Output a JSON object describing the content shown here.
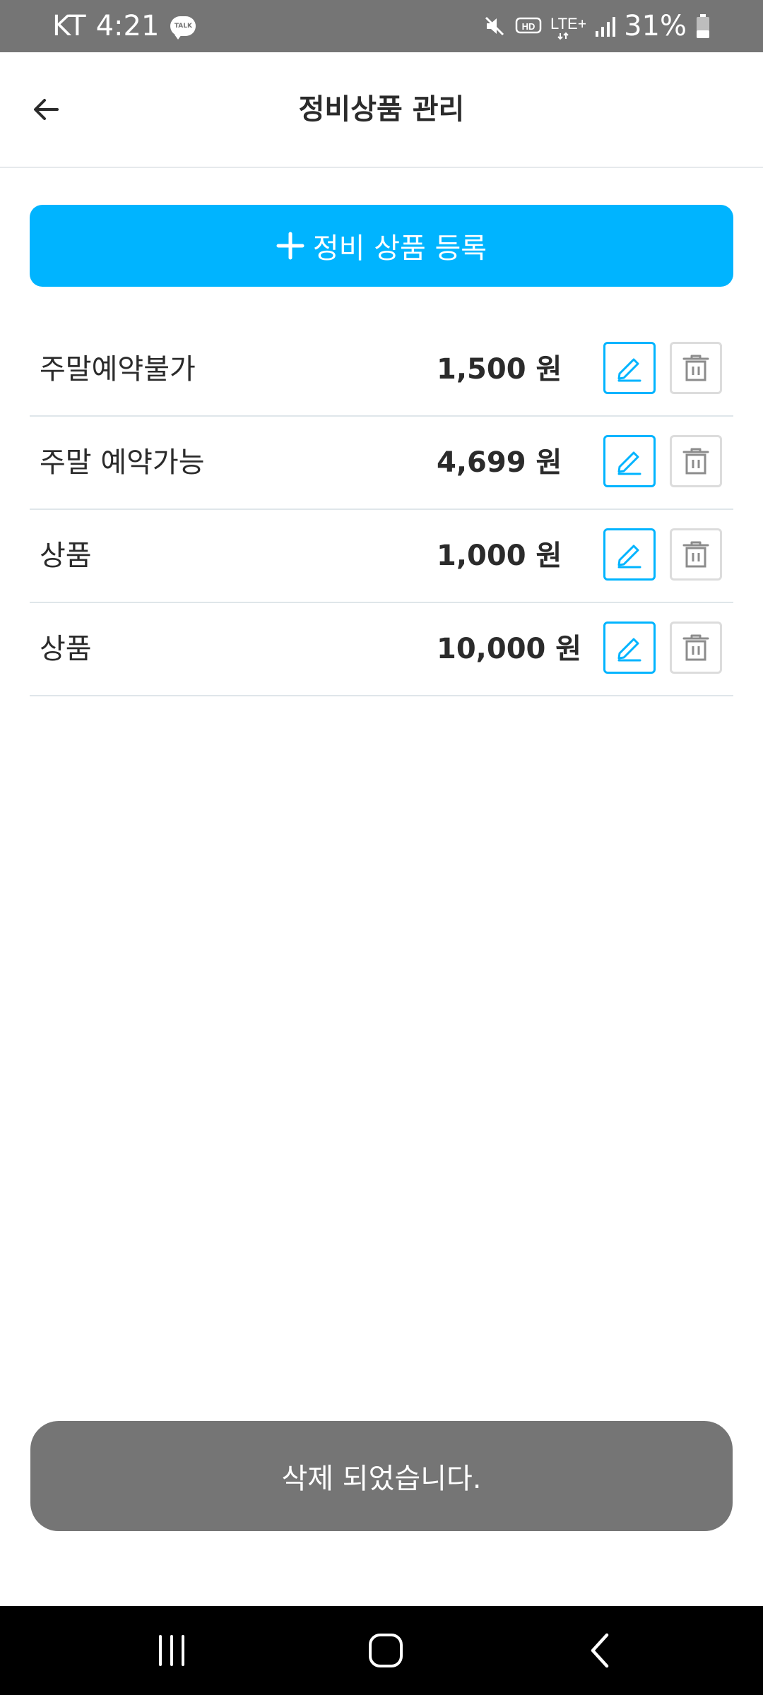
{
  "status_bar": {
    "carrier": "KT",
    "time": "4:21",
    "talk_badge": "TALK",
    "hd_badge": "HD",
    "network": "LTE+",
    "battery": "31%",
    "icons": [
      "kakaotalk-icon",
      "mute-icon",
      "hd-icon",
      "lte-icon",
      "signal-icon",
      "battery-icon"
    ]
  },
  "header": {
    "title": "정비상품 관리",
    "back_icon": "back-arrow-icon"
  },
  "register_button": {
    "label": "정비 상품 등록",
    "icon": "plus-icon"
  },
  "products": [
    {
      "name": "주말예약불가",
      "price": "1,500",
      "unit": "원"
    },
    {
      "name": "주말 예약가능",
      "price": "4,699",
      "unit": "원"
    },
    {
      "name": "상품",
      "price": "1,000",
      "unit": "원"
    },
    {
      "name": "상품",
      "price": "10,000",
      "unit": "원"
    }
  ],
  "row_actions": {
    "edit_icon": "pencil-icon",
    "delete_icon": "trash-icon"
  },
  "toast": {
    "message": "삭제 되었습니다."
  },
  "nav_bar": {
    "buttons": [
      "recent-apps-icon",
      "home-icon",
      "back-icon"
    ]
  },
  "colors": {
    "accent": "#00b4ff",
    "status_bar": "#757575",
    "toast_bg": "#757575",
    "nav_bg": "#000000",
    "text": "#2b2b2b",
    "divider": "#dfe6ea"
  }
}
